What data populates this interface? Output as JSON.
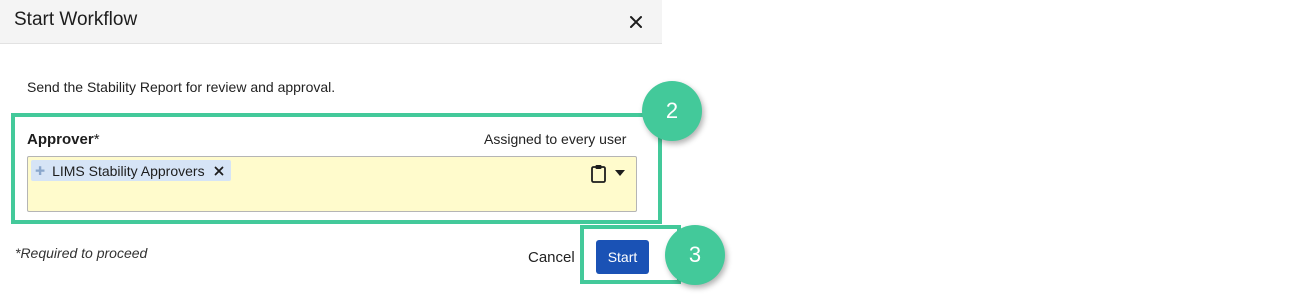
{
  "dialog": {
    "title": "Start Workflow",
    "description": "Send the Stability Report for review and approval.",
    "approver_field": {
      "label": "Approver",
      "required_marker": "*",
      "assignment_note": "Assigned to every user",
      "selected_items": [
        {
          "label": "LIMS Stability Approvers"
        }
      ],
      "background_color": "#fffbcc"
    },
    "required_note": "*Required to proceed",
    "cancel_label": "Cancel",
    "start_label": "Start"
  },
  "icons": {
    "close": "close-icon",
    "clipboard": "clipboard-icon",
    "dropdown": "caret-down-icon",
    "chip_remove": "remove-icon",
    "chip_drag": "drag-handle-icon"
  },
  "annotations": {
    "color": "#43c99a",
    "callouts": [
      {
        "number": "2"
      },
      {
        "number": "3"
      }
    ]
  },
  "colors": {
    "primary_button": "#1a52b5",
    "chip": "#d6e4f6",
    "header": "#f4f4f4"
  }
}
